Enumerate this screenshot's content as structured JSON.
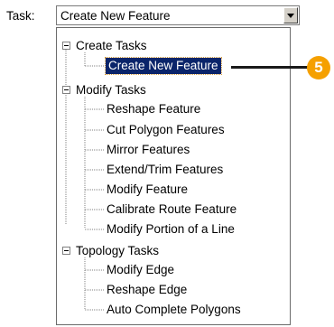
{
  "task_label": "Task:",
  "task_combo": {
    "value": "Create New Feature"
  },
  "tree": {
    "groups": [
      {
        "label": "Create Tasks",
        "items": [
          {
            "label": "Create New Feature",
            "selected": true
          }
        ]
      },
      {
        "label": "Modify Tasks",
        "items": [
          {
            "label": "Reshape Feature"
          },
          {
            "label": "Cut Polygon Features"
          },
          {
            "label": "Mirror Features"
          },
          {
            "label": "Extend/Trim Features"
          },
          {
            "label": "Modify Feature"
          },
          {
            "label": "Calibrate Route Feature"
          },
          {
            "label": "Modify Portion of a Line"
          }
        ]
      },
      {
        "label": "Topology Tasks",
        "items": [
          {
            "label": "Modify Edge"
          },
          {
            "label": "Reshape Edge"
          },
          {
            "label": "Auto Complete Polygons"
          }
        ]
      }
    ]
  },
  "callout": {
    "number": "5",
    "color": "#f5a000"
  },
  "colors": {
    "selection": "#0a246a",
    "selection_text": "#ffffff"
  }
}
